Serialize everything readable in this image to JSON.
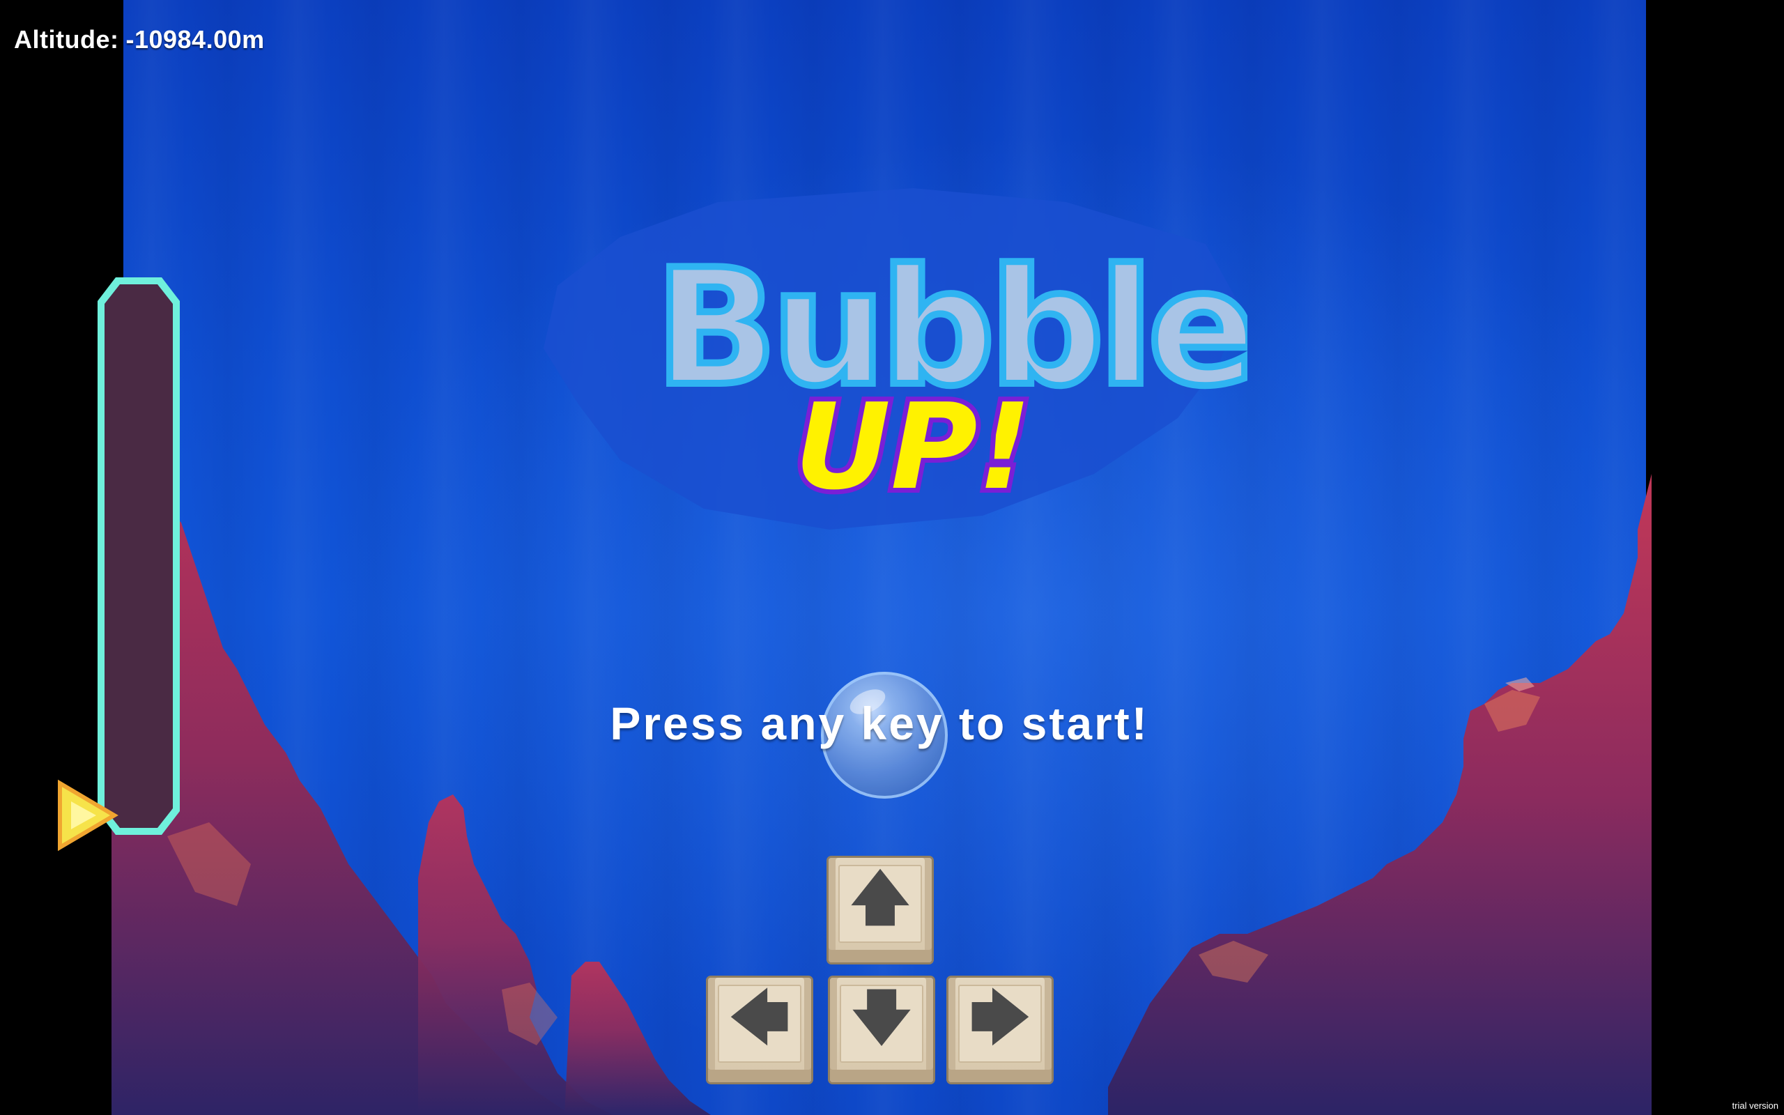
{
  "hud": {
    "altitude_label": "Altitude:",
    "altitude_value": "-10984.00m"
  },
  "title": {
    "line1": "Bubble",
    "line2": "UP!"
  },
  "prompt": {
    "text": "Press any key to start!"
  },
  "controls": {
    "keys": [
      {
        "name": "up",
        "icon": "arrow-up-icon",
        "glyph": "🡅"
      },
      {
        "name": "left",
        "icon": "arrow-left-icon",
        "glyph": "🡄"
      },
      {
        "name": "down",
        "icon": "arrow-down-icon",
        "glyph": "🡇"
      },
      {
        "name": "right",
        "icon": "arrow-right-icon",
        "glyph": "🡆"
      }
    ]
  },
  "depth_meter": {
    "level": 0.97
  },
  "watermark": "trial version",
  "colors": {
    "water_top": "#0b3fc0",
    "water_mid": "#1155d8",
    "meter_border": "#6ff0dc",
    "meter_fill": "#4a2a44",
    "pointer": "#f6e34a",
    "logo_bubble": "#3fb0f0",
    "logo_up_yellow": "#fff200",
    "logo_up_purple": "#7a1fd6",
    "key_face": "#e3d6bf",
    "coral_dark": "#3b2a6e",
    "coral_red": "#c8385a",
    "coral_orange": "#f07a55"
  }
}
